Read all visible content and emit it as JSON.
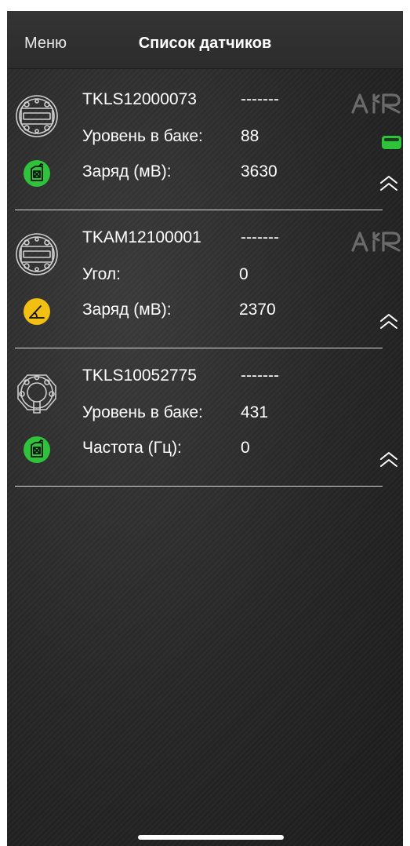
{
  "navbar": {
    "menu_label": "Меню",
    "title": "Список датчиков"
  },
  "sensors": [
    {
      "name": "TKLS12000073",
      "status": "-------",
      "row1_label": "Уровень в баке:",
      "row1_value": "88",
      "row2_label": "Заряд (мВ):",
      "row2_value": "3630",
      "sensor_icon": "fuel-level-sensor-icon",
      "badge_icon": "fuel-canister-icon",
      "badge_color": "#2fc23b",
      "air_logo": "AIR",
      "battery_level": 0.75
    },
    {
      "name": "TKAM12100001",
      "status": "-------",
      "row1_label": "Угол:",
      "row1_value": "0",
      "row2_label": "Заряд (мВ):",
      "row2_value": "2370",
      "sensor_icon": "fuel-level-sensor-icon",
      "badge_icon": "angle-icon",
      "badge_color": "#f2c012",
      "air_logo": "AIR"
    },
    {
      "name": "TKLS10052775",
      "status": "-------",
      "row1_label": "Уровень в баке:",
      "row1_value": "431",
      "row2_label": "Частота (Гц):",
      "row2_value": "0",
      "sensor_icon": "flange-sensor-icon",
      "badge_icon": "fuel-canister-icon",
      "badge_color": "#2fc23b"
    }
  ],
  "colors": {
    "background": "#262626",
    "navbar": "#303030",
    "text": "#ffffff",
    "divider": "#d9d9d9",
    "green": "#2fc23b",
    "yellow": "#f2c012",
    "air_logo": "#6b6b6b"
  }
}
